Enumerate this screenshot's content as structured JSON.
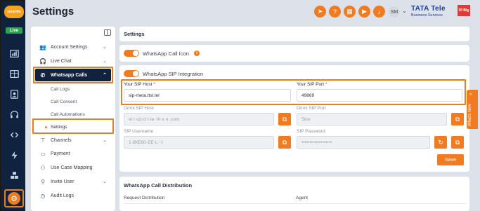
{
  "rail": {
    "logo_text": "smartflo",
    "live_badge": "Live",
    "icons": [
      "analytics-icon",
      "table-icon",
      "contacts-icon",
      "headset-icon",
      "code-icon",
      "bolt-icon",
      "boxes-icon",
      "gear-icon"
    ]
  },
  "header": {
    "title": "Settings",
    "icons": [
      "send-icon",
      "help-icon",
      "gift-icon",
      "play-icon",
      "bell-icon",
      "help-circle-icon"
    ],
    "avatar_initials": "SM",
    "brand_name": "TATA Tele",
    "brand_sub": "Business Services",
    "brand_badge": "30 Big"
  },
  "sidebar": {
    "items": [
      {
        "label": "Account Settings",
        "icon": "users-icon"
      },
      {
        "label": "Live Chat",
        "icon": "headphones-icon"
      },
      {
        "label": "Whatsapp Calls",
        "icon": "whatsapp-icon"
      },
      {
        "label": "Channels",
        "icon": "hierarchy-icon"
      },
      {
        "label": "Payment",
        "icon": "wallet-icon"
      },
      {
        "label": "Use Case Mapping",
        "icon": "mapping-icon"
      },
      {
        "label": "Invite User",
        "icon": "user-plus-icon"
      },
      {
        "label": "Audit Logs",
        "icon": "clock-icon"
      }
    ],
    "subitems": [
      "Call Logs",
      "Call Consent",
      "Call Automations",
      "Settings"
    ]
  },
  "main": {
    "section_title": "Settings",
    "whatsapp_call_icon_label": "WhatsApp Call Icon",
    "whatsapp_sip_label": "WhatsApp SIP Integration",
    "sip_host_label": "Your SIP Host",
    "sip_host_value": "sip-meta.ttsl.tel",
    "sip_port_label": "Your SIP Port",
    "sip_port_value": "49869",
    "omni_host_label": "Omni SIP Host",
    "omni_host_value": "sl·r·cd·cl·l·ta  ·ih·s·n·.com",
    "omni_port_label": "Omni SIP Port",
    "omni_port_value": "5ioo",
    "sip_username_label": "SIP Username",
    "sip_username_value": "1·ØŒ8ß·EE·L·'·l",
    "sip_password_label": "SIP Password",
    "sip_password_value": "•••••••••••••••••••",
    "save_label": "Save",
    "distribution_title": "WhatsApp Call Distribution",
    "request_distribution_label": "Request Distribution",
    "agent_label": "Agent"
  },
  "whats_new": "What's New",
  "colors": {
    "accent": "#f07b21",
    "navy": "#0f2340",
    "highlight": "#e67e22"
  }
}
